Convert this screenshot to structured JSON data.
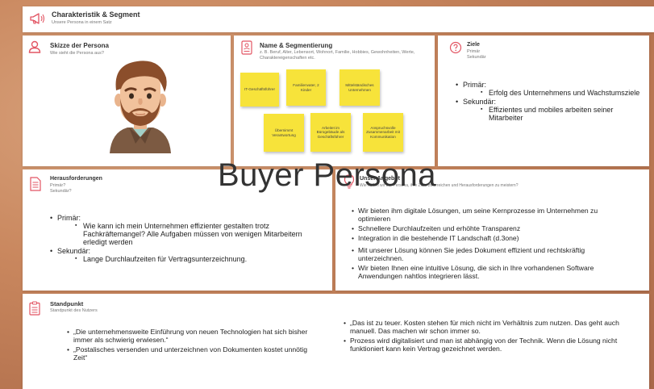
{
  "colors": {
    "accent": "#e25563",
    "sticky": "#f7e33a",
    "background": "#c9875e"
  },
  "header": {
    "title": "Charakteristik & Segment",
    "subtitle": "Unsere Persona in einem Satz",
    "icon": "megaphone-icon"
  },
  "overlay_title": "Buyer Persona",
  "persona": {
    "title": "Skizze der Persona",
    "subtitle": "Wie sieht die Persona aus?",
    "icon": "person-icon"
  },
  "segment": {
    "title": "Name & Segmentierung",
    "subtitle": "z. B. Beruf, Alter, Lebensort, Wohnort, Familie, Hobbies, Gewohnheiten, Werte, Charaktereigenschaften etc.",
    "icon": "id-card-icon",
    "notes": [
      "IT-Geschäftsführer",
      "Familienvater, 2 Kinder",
      "Mittelständisches Unternehmen",
      "Übernimmt Verantwortung",
      "Arbeitet im Bürogebäude als Geschäftsführer",
      "Anspruchsvolle Zusammenarbeit mit Kommunikation"
    ]
  },
  "goals": {
    "title": "Ziele",
    "subtitle_lines": [
      "Primär",
      "Sekundär"
    ],
    "icon": "target-icon",
    "items": [
      {
        "label": "Primär:",
        "sub": [
          "Erfolg des Unternehmens und Wachstumsziele"
        ]
      },
      {
        "label": "Sekundär:",
        "sub": [
          "Effizientes und mobiles arbeiten seiner Mitarbeiter"
        ]
      }
    ]
  },
  "challenges": {
    "title": "Herausforderungen",
    "subtitle_lines": [
      "Primär?",
      "Sekundär?"
    ],
    "icon": "document-icon",
    "items": [
      {
        "label": "Primär:",
        "sub": [
          "Wie kann ich mein Unternehmen effizienter gestalten trotz Fachkräftemangel? Alle Aufgaben müssen von wenigen Mitarbeitern erledigt werden"
        ]
      },
      {
        "label": "Sekundär:",
        "sub": [
          "Lange Durchlaufzeiten für Vertragsunterzeichnung."
        ]
      }
    ]
  },
  "solution": {
    "title": "Unser Angebot",
    "subtitle": "Wie helfen wir der Persona, ihre Ziele zu erreichen und Herausforderungen zu meistern?",
    "icon": "lightbulb-icon",
    "items": [
      "Wir bieten ihm digitale Lösungen, um seine Kernprozesse im Unternehmen zu optimieren",
      "Schnellere Durchlaufzeiten und erhöhte Transparenz",
      "Integration in die bestehende IT Landschaft (d.3one)",
      "Mit unserer Lösung können Sie jedes Dokument effizient und rechtskräftig unterzeichnen.",
      "Wir bieten Ihnen eine intuitive Lösung, die sich in Ihre vorhandenen Software Anwendungen nahtlos integrieren lässt."
    ]
  },
  "standpoint": {
    "title": "Standpunkt",
    "subtitle": "Standpunkt des Nutzers",
    "icon": "clipboard-icon",
    "left_items": [
      "„Die unternehmensweite Einführung von neuen Technologien hat sich bisher immer als schwierig erwiesen.“",
      "„Postalisches versenden und unterzeichnen von Dokumenten kostet unnötig Zeit“"
    ],
    "right_items": [
      "„Das ist zu teuer. Kosten stehen für mich nicht im Verhältnis zum nutzen. Das geht auch manuell. Das machen wir schon immer so.",
      "Prozess wird digitalisiert und man ist abhängig von der Technik. Wenn die Lösung nicht funktioniert kann kein Vertrag gezeichnet werden."
    ]
  }
}
